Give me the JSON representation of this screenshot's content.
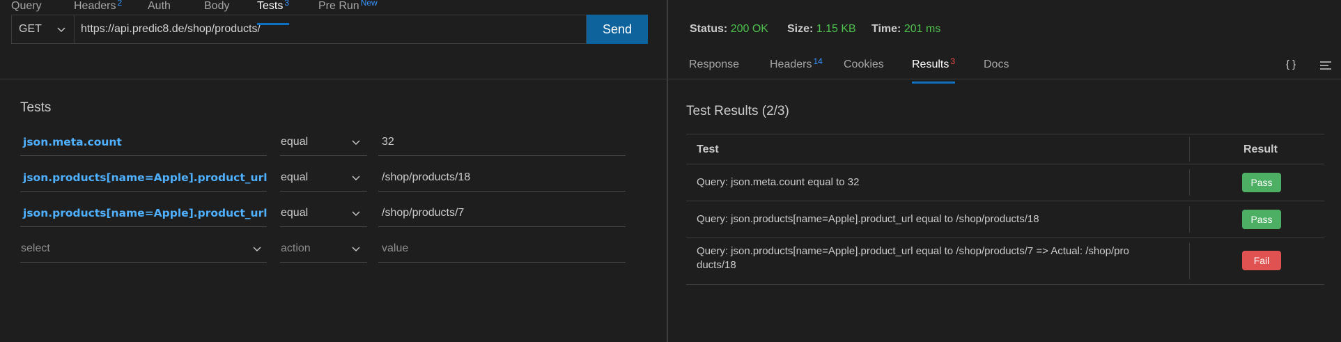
{
  "request": {
    "method": "GET",
    "url": "https://api.predic8.de/shop/products/",
    "send_label": "Send"
  },
  "left_tabs": [
    {
      "label": "Query",
      "badge": ""
    },
    {
      "label": "Headers",
      "badge": "2"
    },
    {
      "label": "Auth",
      "badge": ""
    },
    {
      "label": "Body",
      "badge": ""
    },
    {
      "label": "Tests",
      "badge": "3"
    },
    {
      "label": "Pre Run",
      "badge": "New"
    }
  ],
  "tests_section": {
    "title": "Tests",
    "rows": [
      {
        "query": "json.meta.count",
        "action": "equal",
        "value": "32"
      },
      {
        "query": "json.products[name=Apple].product_url",
        "action": "equal",
        "value": "/shop/products/18"
      },
      {
        "query": "json.products[name=Apple].product_url",
        "action": "equal",
        "value": "/shop/products/7"
      }
    ],
    "placeholders": {
      "query": "select",
      "action": "action",
      "value": "value"
    }
  },
  "response_status": {
    "status_label": "Status:",
    "status_value": "200 OK",
    "size_label": "Size:",
    "size_value": "1.15 KB",
    "time_label": "Time:",
    "time_value": "201 ms"
  },
  "right_tabs": [
    {
      "label": "Response",
      "badge": ""
    },
    {
      "label": "Headers",
      "badge": "14"
    },
    {
      "label": "Cookies",
      "badge": ""
    },
    {
      "label": "Results",
      "badge": "3"
    },
    {
      "label": "Docs",
      "badge": ""
    }
  ],
  "toolbar_icons": [
    "braces-icon",
    "menu-icon"
  ],
  "braces_text": "{ }",
  "results": {
    "title": "Test Results (2/3)",
    "col_test": "Test",
    "col_result": "Result",
    "rows": [
      {
        "test": "Query: json.meta.count equal to 32",
        "result": "Pass"
      },
      {
        "test": "Query: json.products[name=Apple].product_url equal to /shop/products/18",
        "result": "Pass"
      },
      {
        "test_line1": "Query: json.products[name=Apple].product_url equal to /shop/products/7 => Actual: /shop/pro",
        "test_line2": "ducts/18",
        "result": "Fail"
      }
    ]
  },
  "colors": {
    "accent": "#0e639c",
    "query_text": "#4fb0ff",
    "ok_green": "#4ec04e",
    "pass": "#4caf63",
    "fail": "#e05252",
    "badge_blue": "#3794ff",
    "badge_red": "#f14c4c"
  }
}
